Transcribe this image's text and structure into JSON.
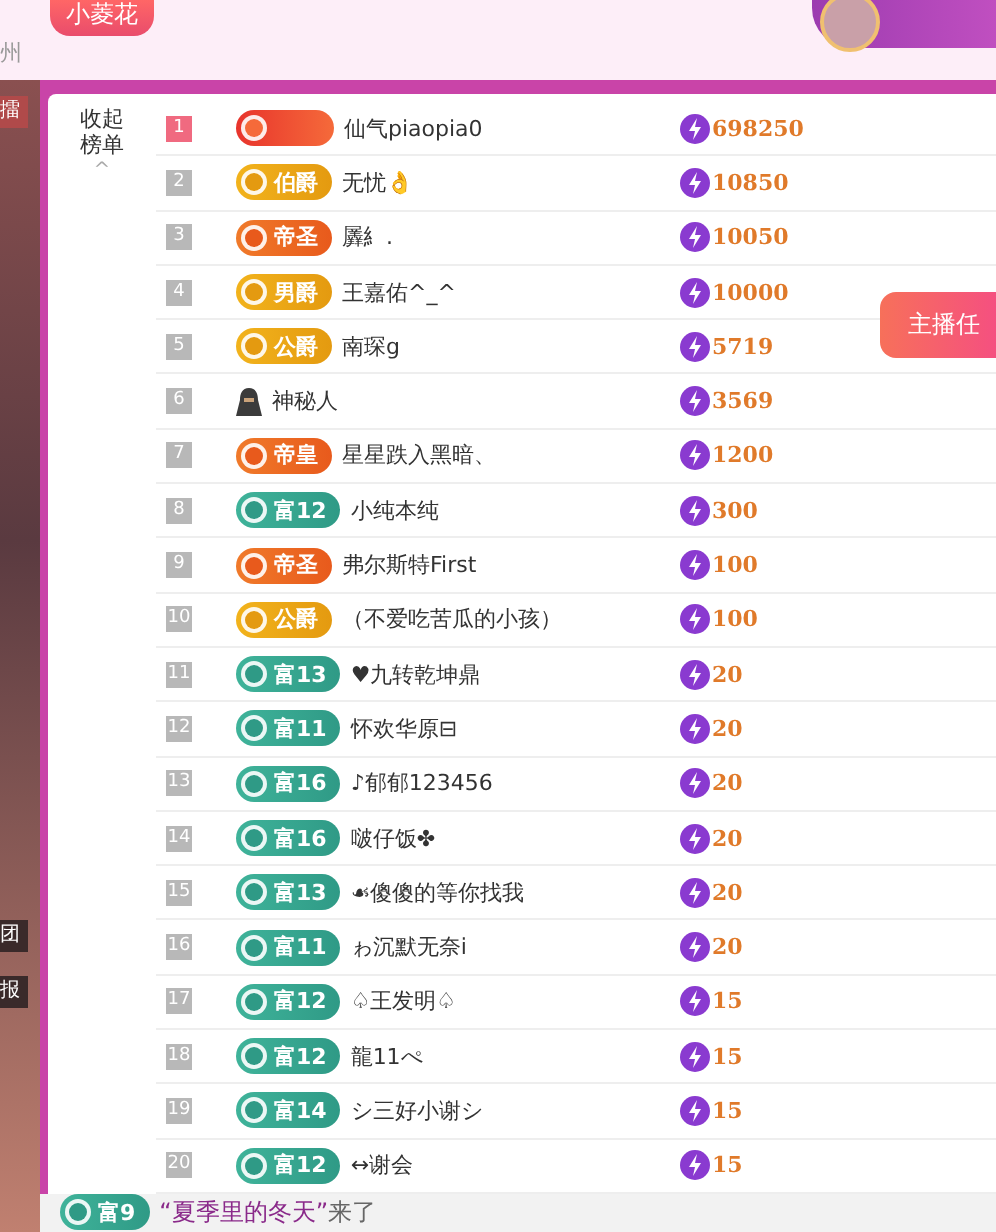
{
  "header": {
    "location": "州",
    "badge": "小菱花"
  },
  "side_tabs": [
    {
      "label": "擂",
      "selected": true
    },
    {
      "label": "团",
      "selected": false
    },
    {
      "label": "报",
      "selected": false
    }
  ],
  "collapse": {
    "label": "收起榜单",
    "caret": "^"
  },
  "task_button": "主播任",
  "rows": [
    {
      "rank": "1",
      "highlight": true,
      "badge": {
        "kind": "red"
      },
      "name": "仙气piaopia0",
      "score": "698250"
    },
    {
      "rank": "2",
      "highlight": false,
      "badge": {
        "kind": "gold",
        "label": "伯爵"
      },
      "name": "无忧👌",
      "score": "10850"
    },
    {
      "rank": "3",
      "highlight": false,
      "badge": {
        "kind": "orange",
        "label": "帝圣"
      },
      "name": "羼糹.",
      "score": "10050"
    },
    {
      "rank": "4",
      "highlight": false,
      "badge": {
        "kind": "gold",
        "label": "男爵"
      },
      "name": "王嘉佑^_^",
      "score": "10000"
    },
    {
      "rank": "5",
      "highlight": false,
      "badge": {
        "kind": "gold",
        "label": "公爵"
      },
      "name": "南琛g",
      "score": "5719"
    },
    {
      "rank": "6",
      "highlight": false,
      "badge": {
        "kind": "mystery"
      },
      "name": "神秘人",
      "score": "3569"
    },
    {
      "rank": "7",
      "highlight": false,
      "badge": {
        "kind": "orange",
        "label": "帝皇"
      },
      "name": "星星跌入黑暗、",
      "score": "1200"
    },
    {
      "rank": "8",
      "highlight": false,
      "badge": {
        "kind": "teal",
        "label": "富12"
      },
      "name": "小纯本纯",
      "score": "300"
    },
    {
      "rank": "9",
      "highlight": false,
      "badge": {
        "kind": "orange",
        "label": "帝圣"
      },
      "name": "弗尔斯特First",
      "score": "100"
    },
    {
      "rank": "10",
      "highlight": false,
      "badge": {
        "kind": "gold",
        "label": "公爵"
      },
      "name": "（不爱吃苦瓜的小孩）",
      "score": "100"
    },
    {
      "rank": "11",
      "highlight": false,
      "badge": {
        "kind": "teal",
        "label": "富13"
      },
      "name": "♥九转乾坤鼎",
      "score": "20"
    },
    {
      "rank": "12",
      "highlight": false,
      "badge": {
        "kind": "teal",
        "label": "富11"
      },
      "name": "怀欢华原⊟",
      "score": "20"
    },
    {
      "rank": "13",
      "highlight": false,
      "badge": {
        "kind": "teal",
        "label": "富16"
      },
      "name": "♪郁郁123456",
      "score": "20"
    },
    {
      "rank": "14",
      "highlight": false,
      "badge": {
        "kind": "teal",
        "label": "富16"
      },
      "name": "啵仔饭✤",
      "score": "20"
    },
    {
      "rank": "15",
      "highlight": false,
      "badge": {
        "kind": "teal",
        "label": "富13"
      },
      "name": "☙傻傻的等你找我",
      "score": "20"
    },
    {
      "rank": "16",
      "highlight": false,
      "badge": {
        "kind": "teal",
        "label": "富11"
      },
      "name": "ゎ沉默无奈i",
      "score": "20"
    },
    {
      "rank": "17",
      "highlight": false,
      "badge": {
        "kind": "teal",
        "label": "富12"
      },
      "name": "♤王发明♤",
      "score": "15"
    },
    {
      "rank": "18",
      "highlight": false,
      "badge": {
        "kind": "teal",
        "label": "富12"
      },
      "name": "龍11ぺ",
      "score": "15"
    },
    {
      "rank": "19",
      "highlight": false,
      "badge": {
        "kind": "teal",
        "label": "富14"
      },
      "name": "シ三好小谢シ",
      "score": "15"
    },
    {
      "rank": "20",
      "highlight": false,
      "badge": {
        "kind": "teal",
        "label": "富12"
      },
      "name": "↔谢会",
      "score": "15"
    }
  ],
  "notice": {
    "badge": {
      "kind": "teal",
      "label": "富9"
    },
    "user": "“夏季里的冬天”",
    "text": "来了"
  }
}
